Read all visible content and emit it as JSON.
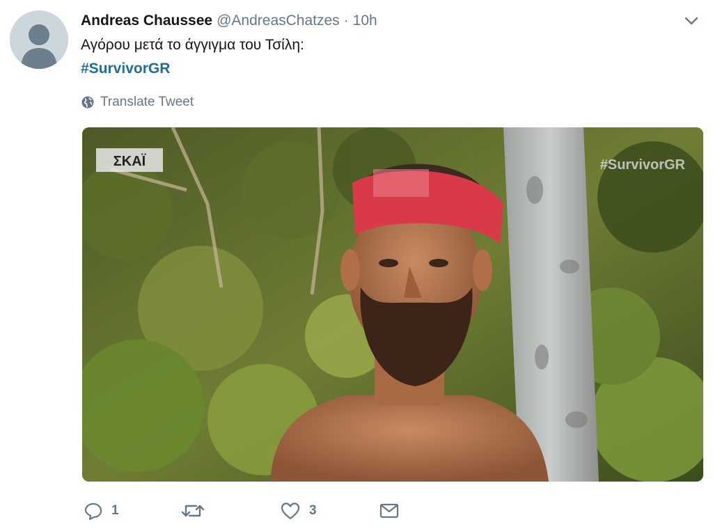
{
  "tweet": {
    "display_name": "Andreas Chaussee",
    "handle": "@AndreasChatzes",
    "separator": "·",
    "time": "10h",
    "text": "Αγόρου μετά το άγγιγμα του Τσίλη:",
    "hashtag": "#SurvivorGR",
    "translate_label": "Translate Tweet"
  },
  "media": {
    "channel_logo": "ΣΚΑΪ",
    "watermark": "#SurvivorGR"
  },
  "actions": {
    "reply_count": "1",
    "retweet_count": "",
    "like_count": "3"
  },
  "icons": {
    "avatar": "default-avatar-icon",
    "caret": "chevron-down-icon",
    "translate": "globe-icon",
    "reply": "reply-icon",
    "retweet": "retweet-icon",
    "like": "heart-icon",
    "dm": "envelope-icon"
  },
  "colors": {
    "hashtag": "#1e6f9e",
    "secondary_text": "#657786",
    "primary_text": "#14171a"
  }
}
